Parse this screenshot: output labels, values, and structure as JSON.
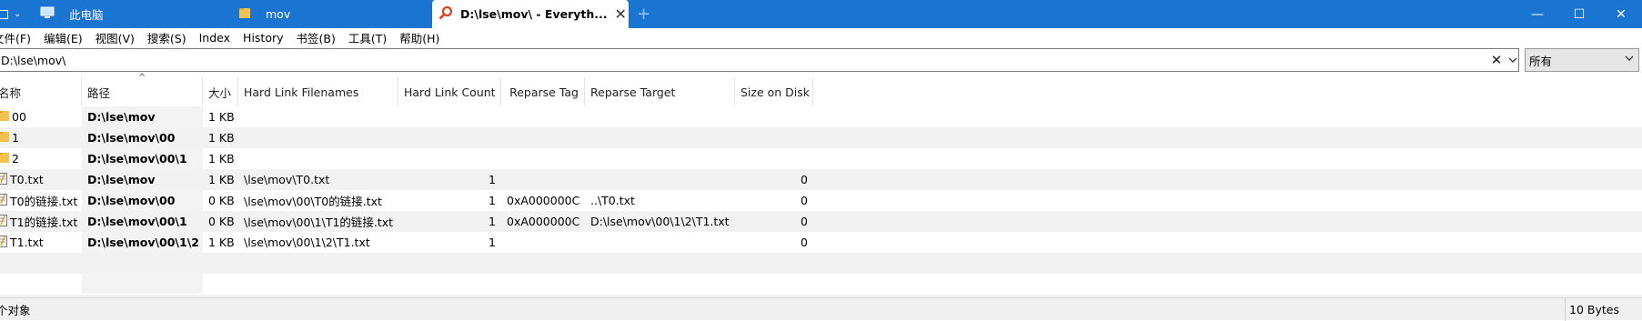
{
  "tabs": [
    {
      "label": "此电脑",
      "icon": "computer-icon"
    },
    {
      "label": "mov",
      "icon": "folder-icon"
    },
    {
      "label": "D:\\lse\\mov\\ - Everyth...",
      "icon": "everything-search-icon",
      "active": true
    }
  ],
  "tab_new_label": "+",
  "window_buttons": {
    "minimize": "—",
    "maximize": "☐",
    "close": "✕"
  },
  "menu": [
    "文件(F)",
    "编辑(E)",
    "视图(V)",
    "搜索(S)",
    "Index",
    "History",
    "书签(B)",
    "工具(T)",
    "帮助(H)"
  ],
  "search": {
    "value": "D:\\lse\\mov\\",
    "clear": "✕"
  },
  "filter": {
    "selected": "所有"
  },
  "columns": [
    "名称",
    "路径",
    "大小",
    "Hard Link Filenames",
    "Hard Link Count",
    "Reparse Tag",
    "Reparse Target",
    "Size on Disk"
  ],
  "rows": [
    {
      "icon": "folder",
      "name": "00",
      "path": "D:\\lse\\mov",
      "size": "1 KB",
      "hl_filenames": "",
      "hl_count": "",
      "reparse_tag": "",
      "reparse_target": "",
      "size_on_disk": ""
    },
    {
      "icon": "folder",
      "name": "1",
      "path": "D:\\lse\\mov\\00",
      "size": "1 KB",
      "hl_filenames": "",
      "hl_count": "",
      "reparse_tag": "",
      "reparse_target": "",
      "size_on_disk": ""
    },
    {
      "icon": "folder",
      "name": "2",
      "path": "D:\\lse\\mov\\00\\1",
      "size": "1 KB",
      "hl_filenames": "",
      "hl_count": "",
      "reparse_tag": "",
      "reparse_target": "",
      "size_on_disk": ""
    },
    {
      "icon": "text-file",
      "name": "T0.txt",
      "path": "D:\\lse\\mov",
      "size": "1 KB",
      "hl_filenames": "\\lse\\mov\\T0.txt",
      "hl_count": "1",
      "reparse_tag": "",
      "reparse_target": "",
      "size_on_disk": "0"
    },
    {
      "icon": "text-file",
      "name": "T0的链接.txt",
      "path": "D:\\lse\\mov\\00",
      "size": "0 KB",
      "hl_filenames": "\\lse\\mov\\00\\T0的链接.txt",
      "hl_count": "1",
      "reparse_tag": "0xA000000C",
      "reparse_target": "..\\T0.txt",
      "size_on_disk": "0"
    },
    {
      "icon": "text-file",
      "name": "T1的链接.txt",
      "path": "D:\\lse\\mov\\00\\1",
      "size": "0 KB",
      "hl_filenames": "\\lse\\mov\\00\\1\\T1的链接.txt",
      "hl_count": "1",
      "reparse_tag": "0xA000000C",
      "reparse_target": "D:\\lse\\mov\\00\\1\\2\\T1.txt",
      "size_on_disk": "0"
    },
    {
      "icon": "text-file",
      "name": "T1.txt",
      "path": "D:\\lse\\mov\\00\\1\\2",
      "size": "1 KB",
      "hl_filenames": "\\lse\\mov\\00\\1\\2\\T1.txt",
      "hl_count": "1",
      "reparse_tag": "",
      "reparse_target": "",
      "size_on_disk": "0"
    }
  ],
  "status": {
    "left": "个对象",
    "right": "10 Bytes"
  },
  "colors": {
    "titlebar": "#1a74d2",
    "row_alt": "#f2f2f2",
    "folder": "#f2c14e"
  }
}
